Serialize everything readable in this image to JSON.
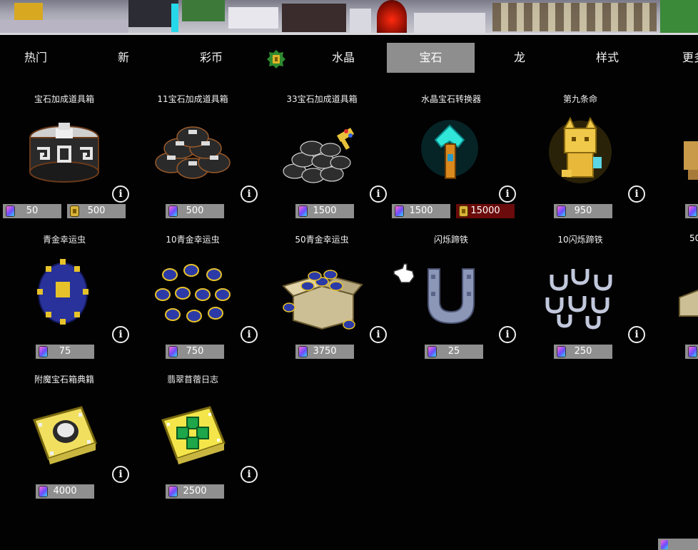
{
  "tabs": [
    {
      "label": "热门",
      "active": false
    },
    {
      "label": "新",
      "active": false
    },
    {
      "label": "彩币",
      "active": false
    },
    {
      "label": "水晶",
      "active": false
    },
    {
      "label": "宝石",
      "active": true
    },
    {
      "label": "龙",
      "active": false
    },
    {
      "label": "样式",
      "active": false
    },
    {
      "label": "更多",
      "active": false
    }
  ],
  "tab_icon": "badge-icon",
  "currency_icons": {
    "gem": "gem-icon",
    "coin": "coin-icon"
  },
  "items": [
    {
      "title": "宝石加成道具箱",
      "art": "gem-booster-box",
      "prices": [
        {
          "currency": "gem",
          "value": "50"
        },
        {
          "currency": "coin",
          "value": "500"
        }
      ]
    },
    {
      "title": "11宝石加成道具箱",
      "art": "gem-booster-box-pile",
      "prices": [
        {
          "currency": "gem",
          "value": "500"
        }
      ]
    },
    {
      "title": "33宝石加成道具箱",
      "art": "gem-booster-box-heap",
      "prices": [
        {
          "currency": "gem",
          "value": "1500"
        }
      ]
    },
    {
      "title": "水晶宝石转换器",
      "art": "crystal-gem-converter",
      "prices": [
        {
          "currency": "gem",
          "value": "1500"
        },
        {
          "currency": "coin",
          "value": "15000"
        }
      ]
    },
    {
      "title": "第九条命",
      "art": "golden-cat",
      "prices": [
        {
          "currency": "gem",
          "value": "950"
        }
      ]
    },
    {
      "title": "青金幸运虫",
      "art": "lapis-scarab",
      "prices": [
        {
          "currency": "gem",
          "value": "75"
        }
      ]
    },
    {
      "title": "10青金幸运虫",
      "art": "lapis-scarab-pile",
      "prices": [
        {
          "currency": "gem",
          "value": "750"
        }
      ]
    },
    {
      "title": "50青金幸运虫",
      "art": "lapis-scarab-box",
      "prices": [
        {
          "currency": "gem",
          "value": "3750"
        }
      ]
    },
    {
      "title": "闪烁蹄铁",
      "art": "horseshoe",
      "prices": [
        {
          "currency": "gem",
          "value": "25"
        }
      ]
    },
    {
      "title": "10闪烁蹄铁",
      "art": "horseshoe-pile",
      "prices": [
        {
          "currency": "gem",
          "value": "250"
        }
      ]
    },
    {
      "title": "附魔宝石箱典籍",
      "art": "enchanted-tome-gold",
      "prices": [
        {
          "currency": "gem",
          "value": "4000"
        }
      ]
    },
    {
      "title": "翡翠苜蓿日志",
      "art": "emerald-clover-journal",
      "prices": [
        {
          "currency": "gem",
          "value": "2500"
        }
      ]
    }
  ],
  "partial_items": [
    {
      "title": "50",
      "prices": []
    }
  ],
  "info_label": "i",
  "colors": {
    "background": "#020202",
    "tab_active": "#8e8e8e",
    "price_bg": "#8f8f8f",
    "price_red": "#6b0b0b"
  }
}
